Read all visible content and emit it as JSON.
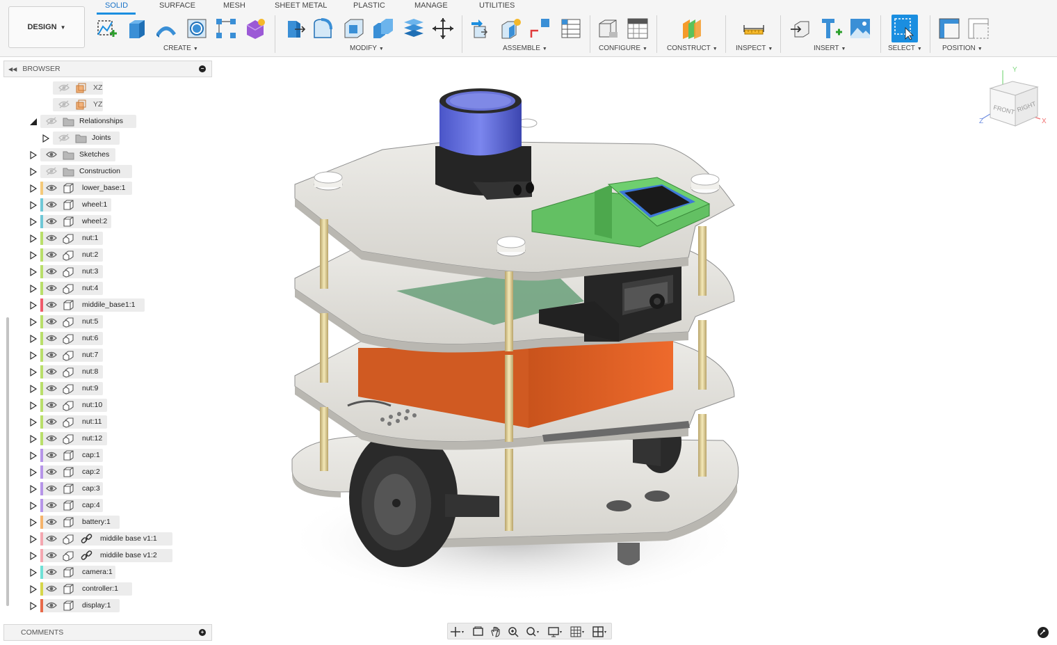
{
  "workspace": {
    "label": "DESIGN"
  },
  "tabs": [
    {
      "label": "SOLID",
      "active": true
    },
    {
      "label": "SURFACE"
    },
    {
      "label": "MESH"
    },
    {
      "label": "SHEET METAL"
    },
    {
      "label": "PLASTIC"
    },
    {
      "label": "MANAGE"
    },
    {
      "label": "UTILITIES"
    }
  ],
  "groups": [
    "CREATE",
    "MODIFY",
    "ASSEMBLE",
    "CONFIGURE",
    "CONSTRUCT",
    "INSPECT",
    "INSERT",
    "SELECT",
    "POSITION"
  ],
  "colors": {
    "accent": "#1a8ee0"
  },
  "browser": {
    "title": "BROWSER",
    "items": [
      {
        "label": "XZ",
        "type": "plane",
        "hidden": true
      },
      {
        "label": "YZ",
        "type": "plane",
        "hidden": true
      },
      {
        "label": "Relationships",
        "type": "folder",
        "hidden": true,
        "expanded": true
      },
      {
        "label": "Joints",
        "type": "folder",
        "hidden": true
      },
      {
        "label": "Sketches",
        "type": "folder"
      },
      {
        "label": "Construction",
        "type": "folder",
        "hidden": true
      },
      {
        "label": "lower_base:1",
        "type": "body",
        "color": "#f4c97a"
      },
      {
        "label": "wheel:1",
        "type": "body",
        "color": "#6fc7d6"
      },
      {
        "label": "wheel:2",
        "type": "body",
        "color": "#6fc7d6"
      },
      {
        "label": "nut:1",
        "type": "component",
        "color": "#b9de6a"
      },
      {
        "label": "nut:2",
        "type": "component",
        "color": "#b9de6a"
      },
      {
        "label": "nut:3",
        "type": "component",
        "color": "#b9de6a"
      },
      {
        "label": "nut:4",
        "type": "component",
        "color": "#b9de6a"
      },
      {
        "label": "middile_base1:1",
        "type": "body",
        "color": "#ef5b6a"
      },
      {
        "label": "nut:5",
        "type": "component",
        "color": "#b9de6a"
      },
      {
        "label": "nut:6",
        "type": "component",
        "color": "#b9de6a"
      },
      {
        "label": "nut:7",
        "type": "component",
        "color": "#b9de6a"
      },
      {
        "label": "nut:8",
        "type": "component",
        "color": "#b9de6a"
      },
      {
        "label": "nut:9",
        "type": "component",
        "color": "#b9de6a"
      },
      {
        "label": "nut:10",
        "type": "component",
        "color": "#b9de6a"
      },
      {
        "label": "nut:11",
        "type": "component",
        "color": "#b9de6a"
      },
      {
        "label": "nut:12",
        "type": "component",
        "color": "#b9de6a"
      },
      {
        "label": "cap:1",
        "type": "body",
        "color": "#b695e8"
      },
      {
        "label": "cap:2",
        "type": "body",
        "color": "#b695e8"
      },
      {
        "label": "cap:3",
        "type": "body",
        "color": "#b695e8"
      },
      {
        "label": "cap:4",
        "type": "body",
        "color": "#b695e8"
      },
      {
        "label": "battery:1",
        "type": "body",
        "color": "#f5b36b"
      },
      {
        "label": "middile base v1:1",
        "type": "linked",
        "color": "#f4a7b0"
      },
      {
        "label": "middile base v1:2",
        "type": "linked",
        "color": "#f4a7b0"
      },
      {
        "label": "camera:1",
        "type": "body",
        "color": "#6fe0d6"
      },
      {
        "label": "controller:1",
        "type": "body",
        "color": "#d6d64a"
      },
      {
        "label": "display:1",
        "type": "body",
        "color": "#e86a4a"
      }
    ]
  },
  "comments": {
    "title": "COMMENTS"
  },
  "viewcube": {
    "front": "FRONT",
    "right": "RIGHT",
    "x": "X",
    "y": "Y",
    "z": "Z"
  }
}
